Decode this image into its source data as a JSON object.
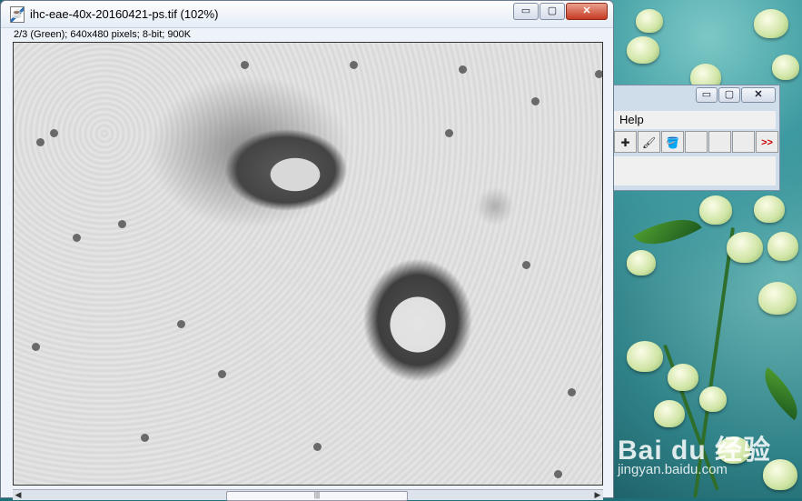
{
  "image_window": {
    "title": "ihc-eae-40x-20160421-ps.tif (102%)",
    "info": "2/3 (Green); 640x480 pixels; 8-bit; 900K",
    "controls": {
      "minimize": "▭",
      "maximize": "▢",
      "close": "✕"
    },
    "scroll_thumb_grip": "|||"
  },
  "toolbar_window": {
    "controls": {
      "minimize": "▭",
      "maximize": "▢",
      "close": "✕"
    },
    "menu": [
      "Help"
    ],
    "tools": [
      {
        "icon": "dropper-icon",
        "glyph": "✚"
      },
      {
        "icon": "brush-icon",
        "glyph": "🖌"
      },
      {
        "icon": "paint-bucket-icon",
        "glyph": "🪣"
      },
      {
        "icon": "empty-slot",
        "glyph": ""
      },
      {
        "icon": "empty-slot",
        "glyph": ""
      },
      {
        "icon": "empty-slot",
        "glyph": ""
      },
      {
        "icon": "more-tools-icon",
        "glyph": ">>"
      }
    ]
  },
  "desktop": {
    "watermark_logo": "Bai du 经验",
    "watermark_url": "jingyan.baidu.com"
  },
  "colors": {
    "close_red": "#c63a22",
    "wallpaper_teal": "#1f6f78",
    "more_red": "#cc0000"
  }
}
